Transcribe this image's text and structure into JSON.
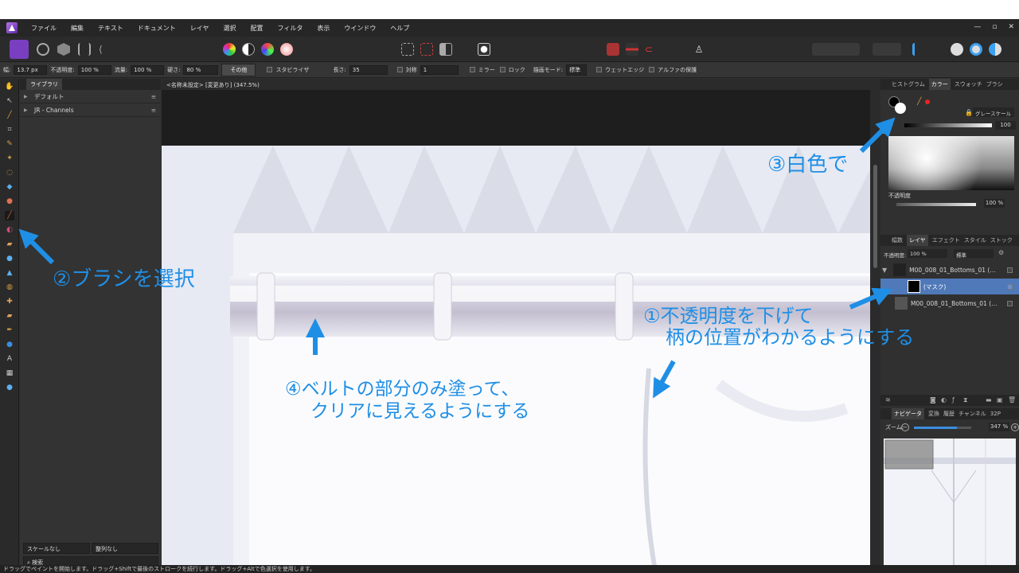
{
  "menu": [
    "ファイル",
    "編集",
    "テキスト",
    "ドキュメント",
    "レイヤ",
    "選択",
    "配置",
    "フィルタ",
    "表示",
    "ウインドウ",
    "ヘルプ"
  ],
  "window_controls": [
    "—",
    "▫",
    "✕"
  ],
  "context": {
    "width_label": "幅:",
    "width_value": "13.7 px",
    "opacity_label": "不透明度:",
    "opacity_value": "100 %",
    "flow_label": "流量:",
    "flow_value": "100 %",
    "hardness_label": "硬さ:",
    "hardness_value": "80 %",
    "more_button": "その他",
    "stabilizer_label": "スタビライザ",
    "length_label": "長さ:",
    "length_value": "35",
    "symmetry_label": "対称",
    "symmetry_value": "1",
    "mirror_label": "ミラー",
    "lock_label": "ロック",
    "blend_label": "描画モード:",
    "blend_value": "標準",
    "wet_label": "ウェットエッジ",
    "alpha_label": "アルファの保護"
  },
  "library": {
    "tab": "ライブラリ",
    "items": [
      "デフォルト",
      "JR - Channels"
    ],
    "scale_select": "スケールなし",
    "sort_select": "整列なし",
    "search_placeholder": "検索"
  },
  "document": {
    "tab_title": "<名称未設定> [変更あり] (347.5%)"
  },
  "color_panel": {
    "tabs": [
      "ヒストグラム",
      "カラー",
      "スウォッチ",
      "ブラシ"
    ],
    "active_tab": "カラー",
    "mode": "グレースケール",
    "gray_label": "グレー",
    "gray_value": "100",
    "opacity_label": "不透明度",
    "opacity_value": "100 %"
  },
  "layers_panel": {
    "tabs": [
      "幅数",
      "レイヤ",
      "エフェクト",
      "スタイル",
      "ストック"
    ],
    "active_tab": "レイヤ",
    "opacity_label": "不透明度:",
    "opacity_value": "100 %",
    "blend_value": "標準",
    "layers": [
      {
        "name": "M00_008_01_Bottoms_01 (…",
        "selected": false
      },
      {
        "name": "(マスク)",
        "selected": true
      },
      {
        "name": "M00_008_01_Bottoms_01 (…",
        "selected": false
      }
    ]
  },
  "navigator_panel": {
    "tabs": [
      "ナビゲータ",
      "変換",
      "履歴",
      "チャンネル",
      "32P"
    ],
    "active_tab": "ナビゲータ",
    "zoom_label": "ズーム:",
    "zoom_value": "347 %",
    "zoom_level": 0.75
  },
  "status_bar": "ドラッグでペイントを開始します。ドラッグ+Shiftで最後のストロークを続行します。ドラッグ+Altで色選択を使用します。",
  "annotations": {
    "step1_line1": "①不透明度を下げて",
    "step1_line2": "柄の位置がわかるようにする",
    "step2": "②ブラシを選択",
    "step3": "③白色で",
    "step4_line1": "④ベルトの部分のみ塗って、",
    "step4_line2": "クリアに見えるようにする"
  },
  "colors": {
    "annotation": "#1f8fe6",
    "accent": "#7a3ec1",
    "selected_layer": "#4f79b8"
  }
}
